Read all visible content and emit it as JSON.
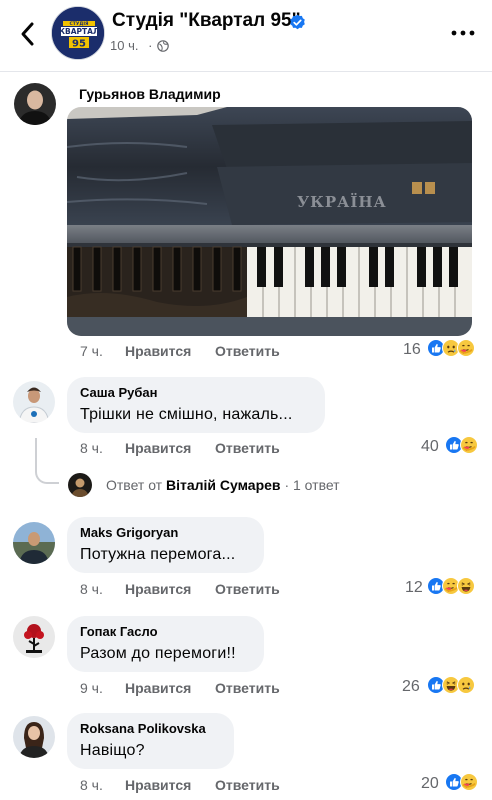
{
  "header": {
    "page_name": "Студія \"Квартал 95\"",
    "time": "10 ч.",
    "separator": "·",
    "avatar_text_top": "СТУДІЯ",
    "avatar_text_main": "КВАРТАЛ",
    "avatar_text_num": "95",
    "icons": [
      "back-chevron-icon",
      "verified-badge-icon",
      "globe-icon",
      "more-dots-icon"
    ],
    "colors": {
      "verified": "#1877f2",
      "avatar_bg": "#1b2d6b"
    }
  },
  "comments": [
    {
      "author": "Гурьянов Владимир",
      "text": "",
      "image_label": "УКРАЇНА",
      "time": "7 ч.",
      "like": "Нравится",
      "reply": "Ответить",
      "reactions_count": "16",
      "reactions": [
        "like",
        "sad",
        "care"
      ]
    },
    {
      "author": "Саша Рубан",
      "text": "Трішки не смішно, нажаль...",
      "time": "8 ч.",
      "like": "Нравится",
      "reply": "Ответить",
      "reactions_count": "40",
      "reactions": [
        "like",
        "care"
      ]
    },
    {
      "author": "Maks Grigoryan",
      "text": "Потужна перемога...",
      "time": "8 ч.",
      "like": "Нравится",
      "reply": "Ответить",
      "reactions_count": "12",
      "reactions": [
        "like",
        "care",
        "haha"
      ]
    },
    {
      "author": "Гопак Гасло",
      "text": "Разом до перемоги!!",
      "time": "9 ч.",
      "like": "Нравится",
      "reply": "Ответить",
      "reactions_count": "26",
      "reactions": [
        "like",
        "haha",
        "sad"
      ]
    },
    {
      "author": "Roksana Polikovska",
      "text": "Навіщо?",
      "time": "8 ч.",
      "like": "Нравится",
      "reply": "Ответить",
      "reactions_count": "20",
      "reactions": [
        "like",
        "care"
      ]
    }
  ],
  "reply_thread": {
    "prefix": "Ответ от",
    "author": "Віталій Сумарев",
    "separator": "·",
    "count": "1 ответ"
  }
}
